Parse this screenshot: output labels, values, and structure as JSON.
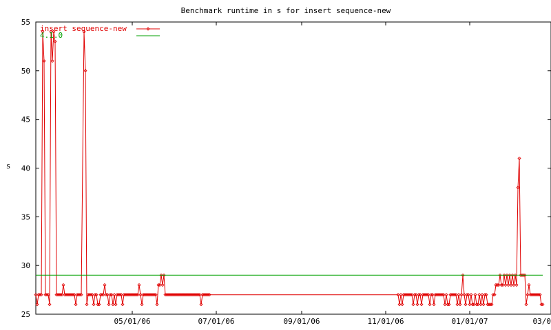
{
  "chart_data": {
    "type": "line",
    "title": "Benchmark runtime in s for insert sequence-new",
    "xlabel": "",
    "ylabel": "s",
    "x_range": [
      "2006-02-20",
      "2007-03-01"
    ],
    "ylim": [
      25,
      55
    ],
    "y_ticks": [
      25,
      30,
      35,
      40,
      45,
      50,
      55
    ],
    "x_ticks": [
      {
        "date": "2006-05-01",
        "label": "05/01/06"
      },
      {
        "date": "2006-07-01",
        "label": "07/01/06"
      },
      {
        "date": "2006-09-01",
        "label": "09/01/06"
      },
      {
        "date": "2006-11-01",
        "label": "11/01/06"
      },
      {
        "date": "2007-01-01",
        "label": "01/01/07"
      },
      {
        "date": "2007-03-01",
        "label": "03/01/07"
      }
    ],
    "grid": false,
    "legend_position": "top-left",
    "series": [
      {
        "name": "insert sequence-new",
        "color": "#e00000",
        "marker": "diamond",
        "points": [
          [
            "2006-02-20",
            27
          ],
          [
            "2006-02-21",
            26
          ],
          [
            "2006-02-22",
            27
          ],
          [
            "2006-02-23",
            27
          ],
          [
            "2006-02-24",
            27
          ],
          [
            "2006-02-25",
            54
          ],
          [
            "2006-02-26",
            51
          ],
          [
            "2006-02-27",
            27
          ],
          [
            "2006-02-28",
            27
          ],
          [
            "2006-03-01",
            27
          ],
          [
            "2006-03-02",
            26
          ],
          [
            "2006-03-03",
            54
          ],
          [
            "2006-03-04",
            51
          ],
          [
            "2006-03-05",
            54
          ],
          [
            "2006-03-06",
            53
          ],
          [
            "2006-03-07",
            27
          ],
          [
            "2006-03-08",
            27
          ],
          [
            "2006-03-09",
            27
          ],
          [
            "2006-03-10",
            27
          ],
          [
            "2006-03-11",
            27
          ],
          [
            "2006-03-12",
            28
          ],
          [
            "2006-03-13",
            27
          ],
          [
            "2006-03-14",
            27
          ],
          [
            "2006-03-15",
            27
          ],
          [
            "2006-03-16",
            27
          ],
          [
            "2006-03-17",
            27
          ],
          [
            "2006-03-18",
            27
          ],
          [
            "2006-03-19",
            27
          ],
          [
            "2006-03-20",
            27
          ],
          [
            "2006-03-21",
            26
          ],
          [
            "2006-03-22",
            27
          ],
          [
            "2006-03-23",
            27
          ],
          [
            "2006-03-24",
            27
          ],
          [
            "2006-03-25",
            27
          ],
          [
            "2006-03-27",
            54
          ],
          [
            "2006-03-28",
            50
          ],
          [
            "2006-03-29",
            26
          ],
          [
            "2006-03-30",
            27
          ],
          [
            "2006-03-31",
            27
          ],
          [
            "2006-04-01",
            27
          ],
          [
            "2006-04-02",
            27
          ],
          [
            "2006-04-03",
            26
          ],
          [
            "2006-04-04",
            27
          ],
          [
            "2006-04-05",
            27
          ],
          [
            "2006-04-06",
            26
          ],
          [
            "2006-04-07",
            26
          ],
          [
            "2006-04-08",
            27
          ],
          [
            "2006-04-09",
            27
          ],
          [
            "2006-04-10",
            27
          ],
          [
            "2006-04-11",
            28
          ],
          [
            "2006-04-12",
            27
          ],
          [
            "2006-04-13",
            27
          ],
          [
            "2006-04-14",
            26
          ],
          [
            "2006-04-15",
            27
          ],
          [
            "2006-04-16",
            27
          ],
          [
            "2006-04-17",
            26
          ],
          [
            "2006-04-18",
            27
          ],
          [
            "2006-04-19",
            26
          ],
          [
            "2006-04-20",
            27
          ],
          [
            "2006-04-21",
            27
          ],
          [
            "2006-04-22",
            27
          ],
          [
            "2006-04-23",
            27
          ],
          [
            "2006-04-24",
            26
          ],
          [
            "2006-04-25",
            27
          ],
          [
            "2006-04-26",
            27
          ],
          [
            "2006-04-27",
            27
          ],
          [
            "2006-04-28",
            27
          ],
          [
            "2006-04-29",
            27
          ],
          [
            "2006-04-30",
            27
          ],
          [
            "2006-05-01",
            27
          ],
          [
            "2006-05-02",
            27
          ],
          [
            "2006-05-03",
            27
          ],
          [
            "2006-05-04",
            27
          ],
          [
            "2006-05-05",
            27
          ],
          [
            "2006-05-06",
            28
          ],
          [
            "2006-05-07",
            27
          ],
          [
            "2006-05-08",
            26
          ],
          [
            "2006-05-09",
            27
          ],
          [
            "2006-05-10",
            27
          ],
          [
            "2006-05-11",
            27
          ],
          [
            "2006-05-12",
            27
          ],
          [
            "2006-05-13",
            27
          ],
          [
            "2006-05-14",
            27
          ],
          [
            "2006-05-15",
            27
          ],
          [
            "2006-05-16",
            27
          ],
          [
            "2006-05-17",
            27
          ],
          [
            "2006-05-18",
            27
          ],
          [
            "2006-05-19",
            26
          ],
          [
            "2006-05-20",
            28
          ],
          [
            "2006-05-21",
            28
          ],
          [
            "2006-05-22",
            29
          ],
          [
            "2006-05-23",
            28
          ],
          [
            "2006-05-24",
            29
          ],
          [
            "2006-05-25",
            27
          ],
          [
            "2006-05-26",
            27
          ],
          [
            "2006-05-27",
            27
          ],
          [
            "2006-05-28",
            27
          ],
          [
            "2006-05-29",
            27
          ],
          [
            "2006-05-30",
            27
          ],
          [
            "2006-05-31",
            27
          ],
          [
            "2006-06-01",
            27
          ],
          [
            "2006-06-02",
            27
          ],
          [
            "2006-06-03",
            27
          ],
          [
            "2006-06-04",
            27
          ],
          [
            "2006-06-05",
            27
          ],
          [
            "2006-06-06",
            27
          ],
          [
            "2006-06-07",
            27
          ],
          [
            "2006-06-08",
            27
          ],
          [
            "2006-06-09",
            27
          ],
          [
            "2006-06-10",
            27
          ],
          [
            "2006-06-11",
            27
          ],
          [
            "2006-06-12",
            27
          ],
          [
            "2006-06-13",
            27
          ],
          [
            "2006-06-14",
            27
          ],
          [
            "2006-06-15",
            27
          ],
          [
            "2006-06-16",
            27
          ],
          [
            "2006-06-17",
            27
          ],
          [
            "2006-06-18",
            27
          ],
          [
            "2006-06-19",
            27
          ],
          [
            "2006-06-20",
            26
          ],
          [
            "2006-06-21",
            27
          ],
          [
            "2006-06-22",
            27
          ],
          [
            "2006-06-23",
            27
          ],
          [
            "2006-06-24",
            27
          ],
          [
            "2006-06-25",
            27
          ],
          [
            "2006-06-26",
            27
          ],
          [
            "2006-11-10",
            27
          ],
          [
            "2006-11-11",
            26
          ],
          [
            "2006-11-12",
            27
          ],
          [
            "2006-11-13",
            26
          ],
          [
            "2006-11-14",
            27
          ],
          [
            "2006-11-15",
            27
          ],
          [
            "2006-11-16",
            27
          ],
          [
            "2006-11-17",
            27
          ],
          [
            "2006-11-18",
            27
          ],
          [
            "2006-11-19",
            27
          ],
          [
            "2006-11-20",
            27
          ],
          [
            "2006-11-21",
            26
          ],
          [
            "2006-11-22",
            27
          ],
          [
            "2006-11-23",
            27
          ],
          [
            "2006-11-24",
            26
          ],
          [
            "2006-11-25",
            27
          ],
          [
            "2006-11-26",
            27
          ],
          [
            "2006-11-27",
            26
          ],
          [
            "2006-11-28",
            27
          ],
          [
            "2006-11-29",
            27
          ],
          [
            "2006-11-30",
            27
          ],
          [
            "2006-12-01",
            27
          ],
          [
            "2006-12-02",
            27
          ],
          [
            "2006-12-03",
            26
          ],
          [
            "2006-12-04",
            27
          ],
          [
            "2006-12-05",
            27
          ],
          [
            "2006-12-06",
            26
          ],
          [
            "2006-12-07",
            27
          ],
          [
            "2006-12-08",
            27
          ],
          [
            "2006-12-09",
            27
          ],
          [
            "2006-12-10",
            27
          ],
          [
            "2006-12-11",
            27
          ],
          [
            "2006-12-12",
            27
          ],
          [
            "2006-12-13",
            27
          ],
          [
            "2006-12-14",
            26
          ],
          [
            "2006-12-15",
            27
          ],
          [
            "2006-12-16",
            26
          ],
          [
            "2006-12-17",
            26
          ],
          [
            "2006-12-18",
            27
          ],
          [
            "2006-12-19",
            27
          ],
          [
            "2006-12-20",
            27
          ],
          [
            "2006-12-21",
            27
          ],
          [
            "2006-12-22",
            27
          ],
          [
            "2006-12-23",
            26
          ],
          [
            "2006-12-24",
            27
          ],
          [
            "2006-12-25",
            26
          ],
          [
            "2006-12-26",
            27
          ],
          [
            "2006-12-27",
            29
          ],
          [
            "2006-12-28",
            27
          ],
          [
            "2006-12-29",
            26
          ],
          [
            "2006-12-30",
            27
          ],
          [
            "2006-12-31",
            27
          ],
          [
            "2007-01-01",
            26
          ],
          [
            "2007-01-02",
            27
          ],
          [
            "2007-01-03",
            26
          ],
          [
            "2007-01-04",
            26
          ],
          [
            "2007-01-05",
            27
          ],
          [
            "2007-01-06",
            26
          ],
          [
            "2007-01-07",
            26
          ],
          [
            "2007-01-08",
            27
          ],
          [
            "2007-01-09",
            26
          ],
          [
            "2007-01-10",
            27
          ],
          [
            "2007-01-11",
            26
          ],
          [
            "2007-01-12",
            27
          ],
          [
            "2007-01-13",
            27
          ],
          [
            "2007-01-14",
            26
          ],
          [
            "2007-01-15",
            26
          ],
          [
            "2007-01-16",
            26
          ],
          [
            "2007-01-17",
            26
          ],
          [
            "2007-01-18",
            27
          ],
          [
            "2007-01-19",
            27
          ],
          [
            "2007-01-20",
            28
          ],
          [
            "2007-01-21",
            28
          ],
          [
            "2007-01-22",
            28
          ],
          [
            "2007-01-23",
            29
          ],
          [
            "2007-01-24",
            28
          ],
          [
            "2007-01-25",
            28
          ],
          [
            "2007-01-26",
            29
          ],
          [
            "2007-01-27",
            28
          ],
          [
            "2007-01-28",
            29
          ],
          [
            "2007-01-29",
            28
          ],
          [
            "2007-01-30",
            29
          ],
          [
            "2007-01-31",
            28
          ],
          [
            "2007-02-01",
            29
          ],
          [
            "2007-02-02",
            28
          ],
          [
            "2007-02-03",
            29
          ],
          [
            "2007-02-04",
            28
          ],
          [
            "2007-02-05",
            38
          ],
          [
            "2007-02-06",
            41
          ],
          [
            "2007-02-07",
            29
          ],
          [
            "2007-02-08",
            29
          ],
          [
            "2007-02-09",
            29
          ],
          [
            "2007-02-10",
            29
          ],
          [
            "2007-02-11",
            26
          ],
          [
            "2007-02-12",
            27
          ],
          [
            "2007-02-13",
            28
          ],
          [
            "2007-02-14",
            27
          ],
          [
            "2007-02-15",
            27
          ],
          [
            "2007-02-16",
            27
          ],
          [
            "2007-02-17",
            27
          ],
          [
            "2007-02-18",
            27
          ],
          [
            "2007-02-19",
            27
          ],
          [
            "2007-02-20",
            27
          ],
          [
            "2007-02-21",
            27
          ],
          [
            "2007-02-22",
            26
          ],
          [
            "2007-02-23",
            26
          ]
        ]
      },
      {
        "name": "4.1.0",
        "color": "#00a000",
        "marker": "none",
        "points": [
          [
            "2006-02-20",
            29
          ],
          [
            "2007-02-23",
            29
          ]
        ]
      }
    ]
  }
}
